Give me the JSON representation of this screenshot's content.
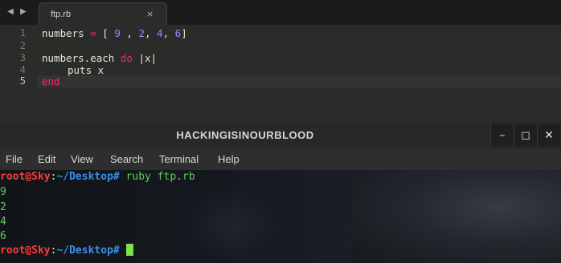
{
  "editor": {
    "nav_left": "◀",
    "nav_right": "▶",
    "tab": {
      "title": "ftp.rb",
      "close": "×"
    },
    "line_numbers": [
      "1",
      "2",
      "3",
      "4",
      "5"
    ],
    "code": {
      "l1_a": "numbers",
      "l1_b": "=",
      "l1_c": "[",
      "l1_d": "9",
      "l1_e": ",",
      "l1_f": "2",
      "l1_g": ",",
      "l1_h": "4",
      "l1_i": ",",
      "l1_j": "6",
      "l1_k": "]",
      "l3_a": "numbers.each",
      "l3_b": "do",
      "l3_c": "|x|",
      "l4": "puts x",
      "l5": "end"
    }
  },
  "terminal": {
    "title": "HACKINGISINOURBLOOD",
    "buttons": {
      "minimize": "–",
      "maximize": "◻",
      "close": "✕"
    },
    "menu": [
      "File",
      "Edit",
      "View",
      "Search",
      "Terminal",
      "Help"
    ],
    "prompt": {
      "user": "root@Sky",
      "sep": ":",
      "path": "~/Desktop",
      "symbol": "#"
    },
    "command": "ruby ftp.rb",
    "output": [
      "9",
      "2",
      "4",
      "6"
    ]
  },
  "colors": {
    "keyword": "#f92672",
    "number": "#ae81ff",
    "prompt_user": "#ff3b3b",
    "prompt_path": "#3b8eea",
    "output": "#5ccf5c"
  }
}
